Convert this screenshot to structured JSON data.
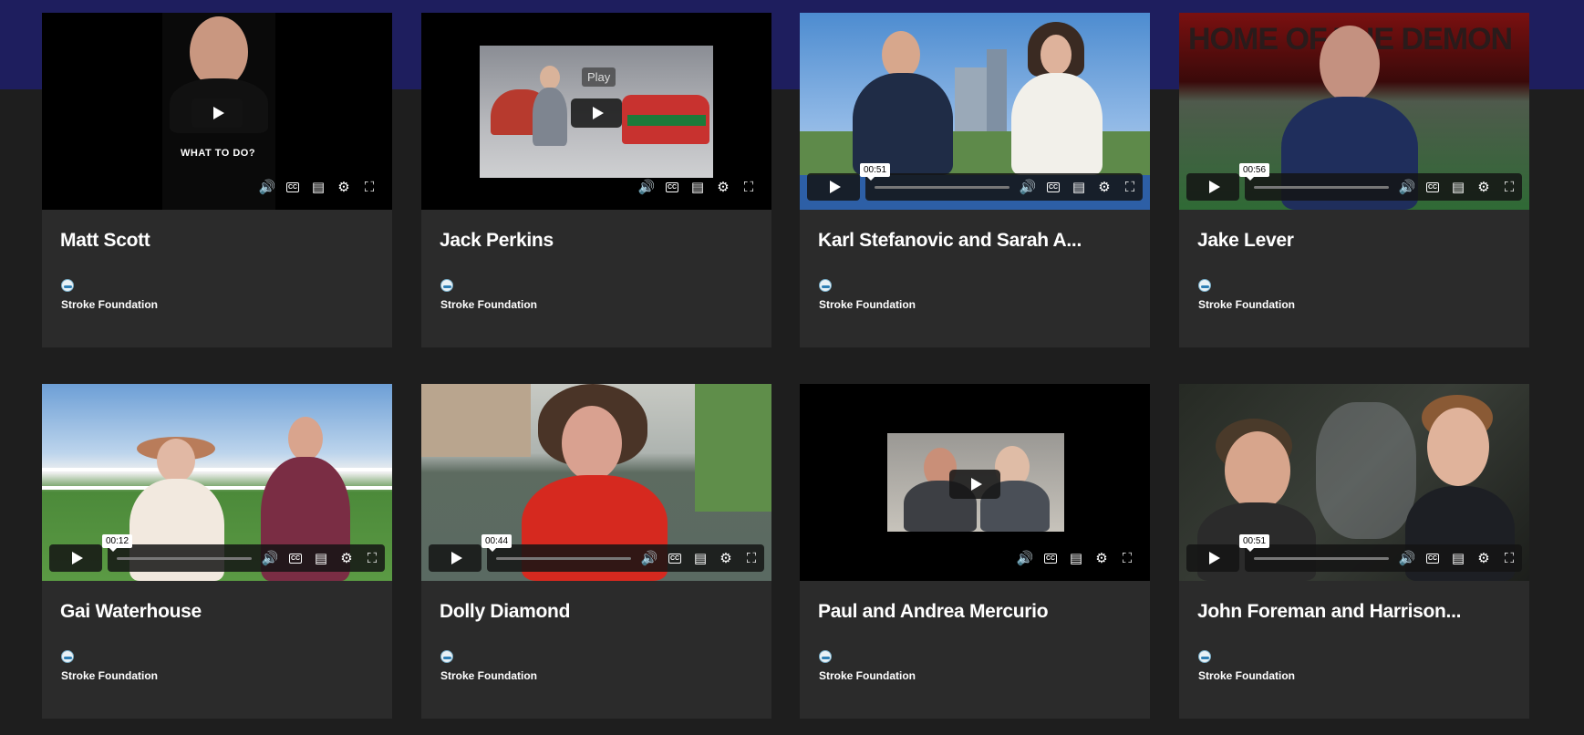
{
  "org_name": "Stroke Foundation",
  "colors": {
    "page_background": "#1e1e1e",
    "top_band": "#1e1e5e",
    "card_background": "#2b2b2b"
  },
  "videos": [
    {
      "title": "Matt Scott",
      "caption": "WHAT TO DO?"
    },
    {
      "title": "Jack Perkins",
      "play_label": "Play"
    },
    {
      "title": "Karl Stefanovic and Sarah A...",
      "time": "00:51"
    },
    {
      "title": "Jake Lever",
      "time": "00:56",
      "background_text": "HOME OF THE DEMON"
    },
    {
      "title": "Gai Waterhouse",
      "time": "00:12"
    },
    {
      "title": "Dolly Diamond",
      "time": "00:44"
    },
    {
      "title": "Paul and Andrea Mercurio"
    },
    {
      "title": "John Foreman and Harrison...",
      "time": "00:51"
    }
  ],
  "control_icons": [
    "volume-icon",
    "closed-captions-icon",
    "transcript-icon",
    "settings-gear-icon",
    "fullscreen-icon"
  ]
}
